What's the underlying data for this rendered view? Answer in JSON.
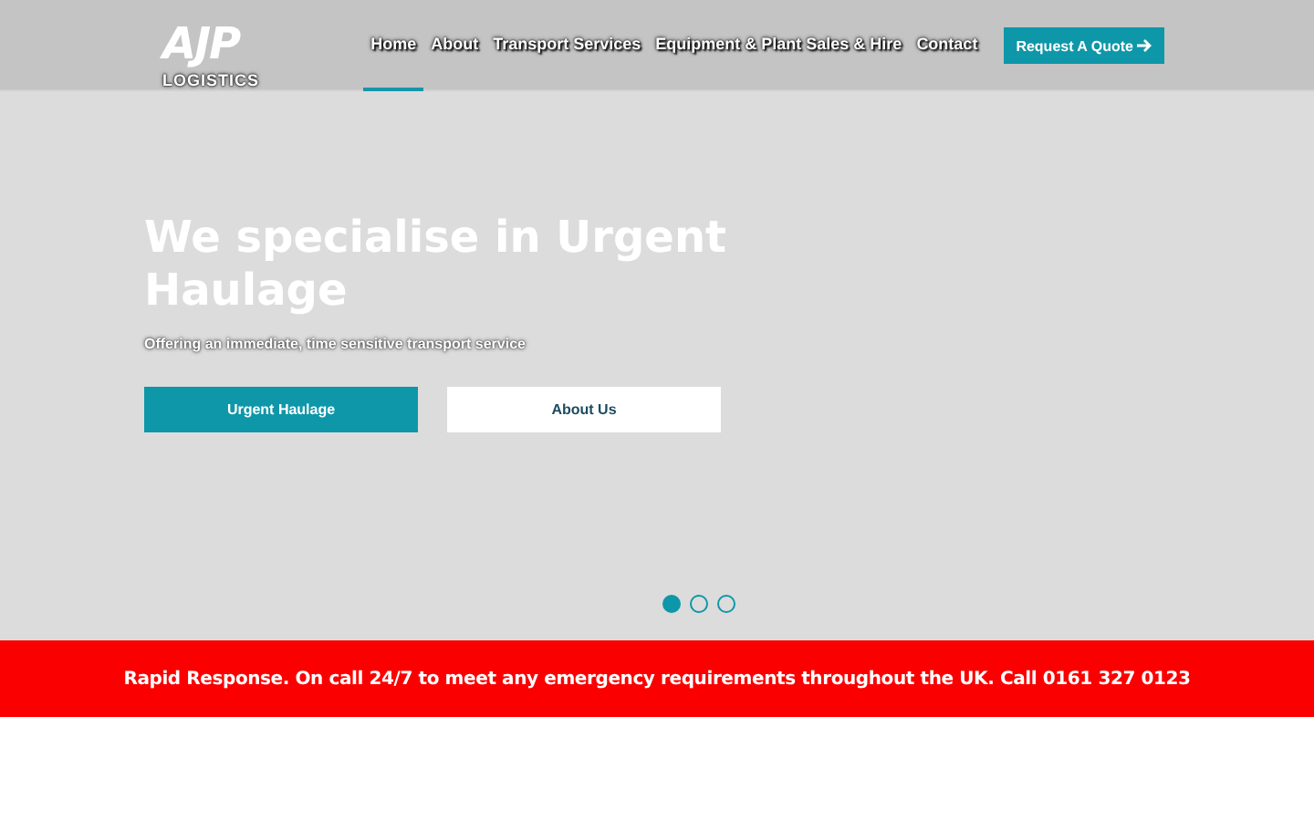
{
  "logo": {
    "mark": "AJP",
    "subtitle": "LOGISTICS"
  },
  "nav": [
    {
      "label": "Home",
      "selected": true
    },
    {
      "label": "About",
      "selected": false
    },
    {
      "label": "Transport Services",
      "selected": false
    },
    {
      "label": "Equipment & Plant Sales & Hire",
      "selected": false
    },
    {
      "label": "Contact",
      "selected": false
    }
  ],
  "quote_button": "Request A Quote",
  "hero": {
    "title": "We specialise in Urgent Haulage",
    "subtitle": "Offering an immediate, time sensitive transport service",
    "buttons": [
      {
        "label": "Urgent Haulage",
        "kind": "primary"
      },
      {
        "label": "About Us",
        "kind": "secondary"
      }
    ],
    "slides": [
      {
        "selected": true
      },
      {
        "selected": false
      },
      {
        "selected": false
      }
    ]
  },
  "banner": "Rapid Response. On call 24/7 to meet any emergency requirements throughout the UK. Call 0161 327 0123"
}
